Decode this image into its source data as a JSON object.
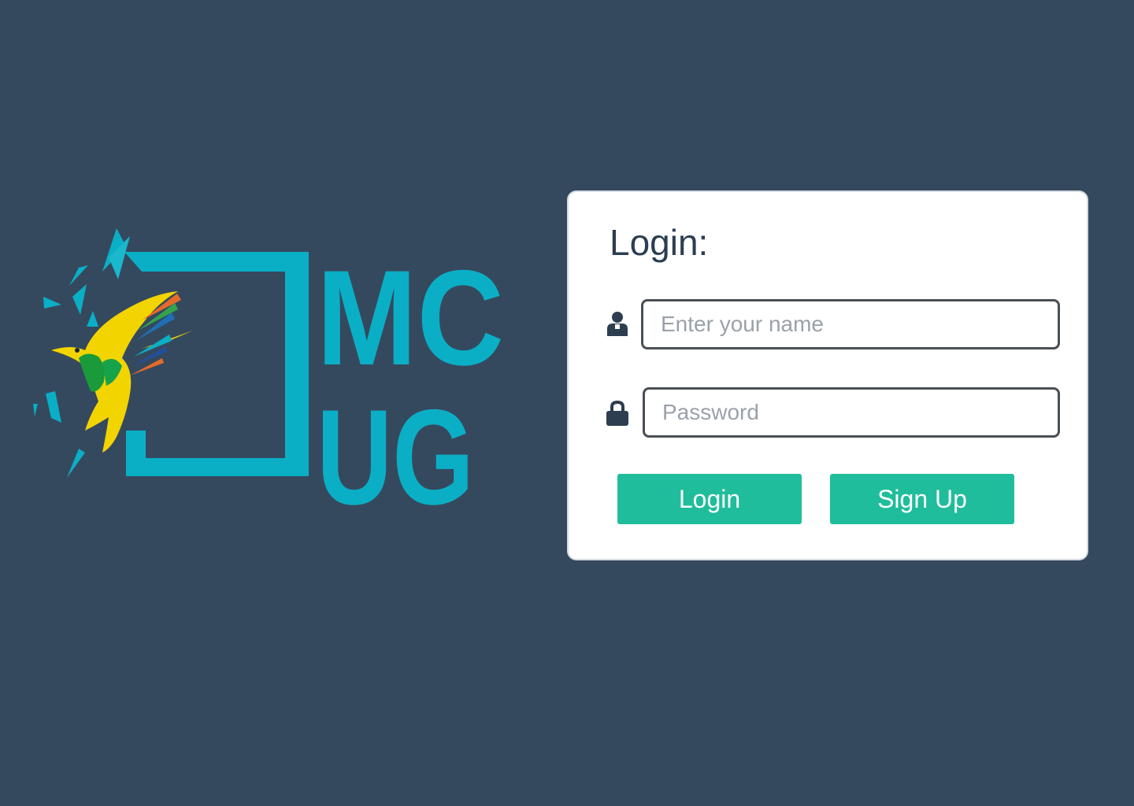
{
  "logo": {
    "text_line1": "MC",
    "text_line2": "UG",
    "icon": "hummingbird-logo-icon",
    "brand_color": "#0aafc6"
  },
  "login_form": {
    "title": "Login:",
    "username": {
      "placeholder": "Enter your name",
      "value": "",
      "icon": "user-icon"
    },
    "password": {
      "placeholder": "Password",
      "value": "",
      "icon": "lock-icon"
    },
    "buttons": {
      "login_label": "Login",
      "signup_label": "Sign Up"
    }
  },
  "colors": {
    "background": "#35495e",
    "card": "#ffffff",
    "accent": "#1fbd9b",
    "title_text": "#2c3e50"
  }
}
